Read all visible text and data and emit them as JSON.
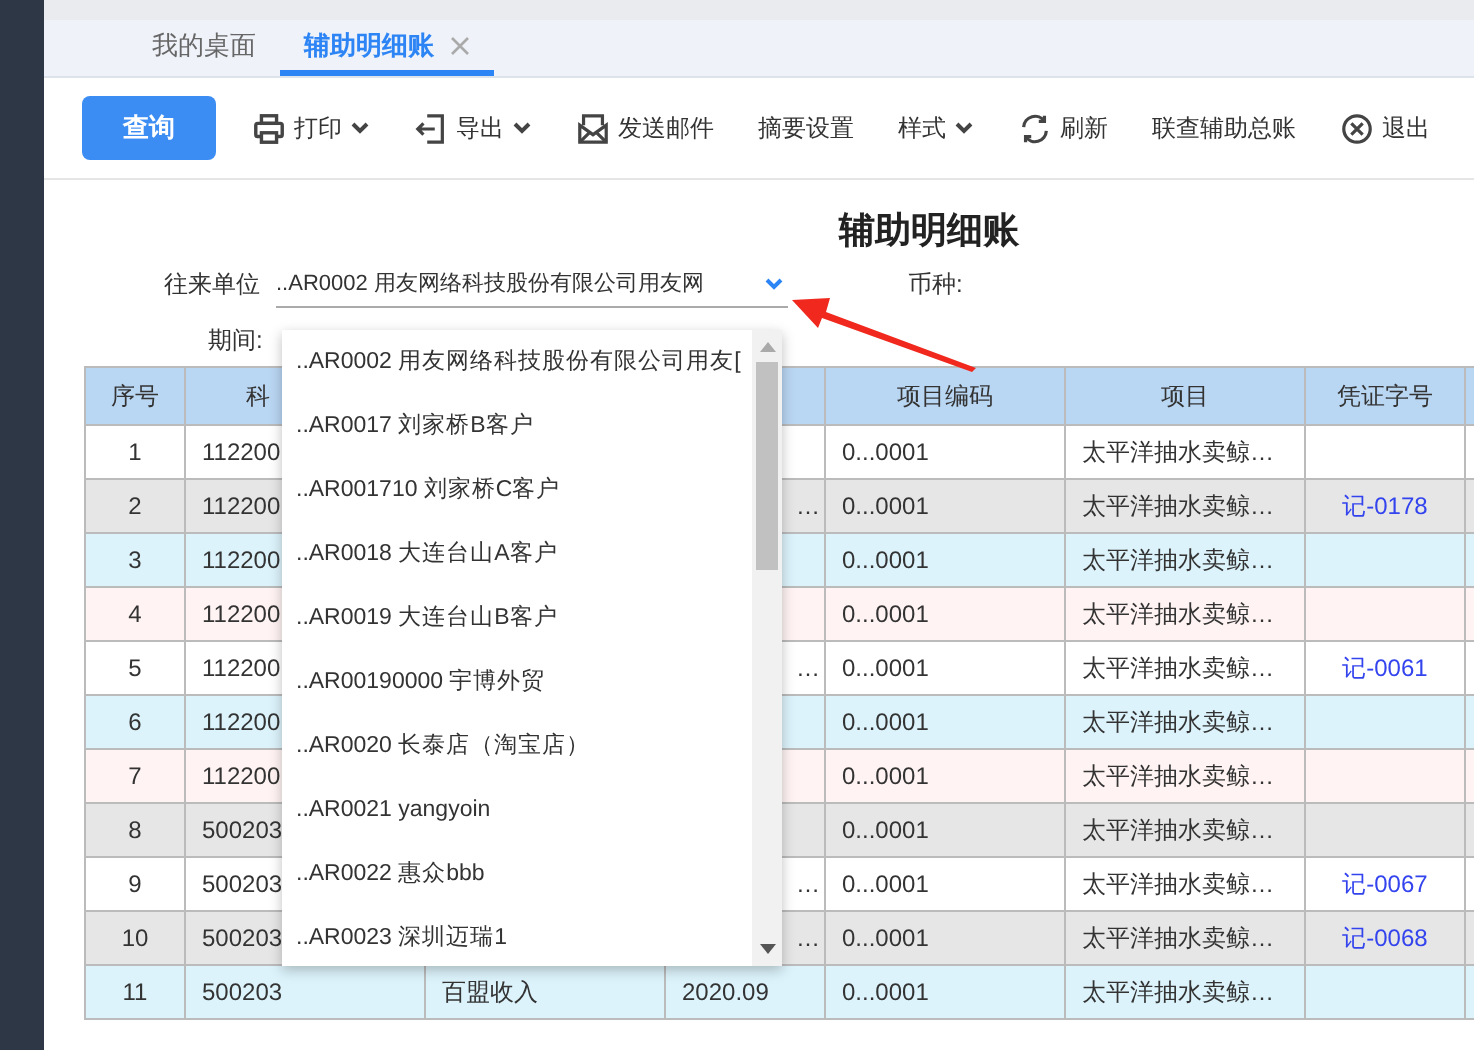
{
  "tabs": [
    {
      "label": "我的桌面",
      "selected": false,
      "closable": false
    },
    {
      "label": "辅助明细账",
      "selected": true,
      "closable": true
    }
  ],
  "toolbar": {
    "query_button": "查询",
    "items": [
      {
        "label": "打印",
        "kind": "print",
        "dropdown": true
      },
      {
        "label": "导出",
        "kind": "export",
        "dropdown": true
      },
      {
        "label": "发送邮件",
        "kind": "mail",
        "dropdown": false
      },
      {
        "label": "摘要设置",
        "kind": "text",
        "dropdown": false
      },
      {
        "label": "样式",
        "kind": "text",
        "dropdown": true
      },
      {
        "label": "刷新",
        "kind": "refresh",
        "dropdown": false
      },
      {
        "label": "联查辅助总账",
        "kind": "text",
        "dropdown": false
      },
      {
        "label": "退出",
        "kind": "exit",
        "dropdown": false
      }
    ]
  },
  "report": {
    "title": "辅助明细账",
    "unit_label": "往来单位",
    "unit_value": "..AR0002 用友网络科技股份有限公司用友网",
    "currency_label": "币种:",
    "period_label": "期间:"
  },
  "dropdown": {
    "options": [
      "..AR0002 用友网络科技股份有限公司用友[",
      "..AR0017 刘家桥B客户",
      "..AR001710 刘家桥C客户",
      "..AR0018 大连台山A客户",
      "..AR0019 大连台山B客户",
      "..AR00190000 宇博外贸",
      "..AR0020 长泰店（淘宝店）",
      "..AR0021 yangyoin",
      "..AR0022 惠众bbb",
      "..AR0023 深圳迈瑞1"
    ]
  },
  "table": {
    "columns": [
      "序号",
      "科",
      "",
      "",
      "项目编码",
      "项目",
      "凭证字号"
    ],
    "rows": [
      {
        "kind": "white",
        "cells": [
          "1",
          "112200",
          "",
          "",
          "0...0001",
          "太平洋抽水卖鲸…",
          ""
        ]
      },
      {
        "kind": "grey",
        "cells": [
          "2",
          "112200",
          "",
          "…",
          "0...0001",
          "太平洋抽水卖鲸…",
          "记-0178"
        ]
      },
      {
        "kind": "blue",
        "cells": [
          "3",
          "112200",
          "",
          "",
          "0...0001",
          "太平洋抽水卖鲸…",
          ""
        ]
      },
      {
        "kind": "pink",
        "cells": [
          "4",
          "112200",
          "",
          "",
          "0...0001",
          "太平洋抽水卖鲸…",
          ""
        ]
      },
      {
        "kind": "white",
        "cells": [
          "5",
          "112200",
          "",
          "…",
          "0...0001",
          "太平洋抽水卖鲸…",
          "记-0061"
        ]
      },
      {
        "kind": "blue",
        "cells": [
          "6",
          "112200",
          "",
          "",
          "0...0001",
          "太平洋抽水卖鲸…",
          ""
        ]
      },
      {
        "kind": "pink",
        "cells": [
          "7",
          "112200",
          "",
          "",
          "0...0001",
          "太平洋抽水卖鲸…",
          ""
        ]
      },
      {
        "kind": "grey",
        "cells": [
          "8",
          "500203",
          "",
          "",
          "0...0001",
          "太平洋抽水卖鲸…",
          ""
        ]
      },
      {
        "kind": "white",
        "cells": [
          "9",
          "500203",
          "",
          "…",
          "0...0001",
          "太平洋抽水卖鲸…",
          "记-0067"
        ]
      },
      {
        "kind": "grey",
        "cells": [
          "10",
          "500203",
          "",
          "…",
          "0...0001",
          "太平洋抽水卖鲸…",
          "记-0068"
        ]
      },
      {
        "kind": "blue",
        "cells": [
          "11",
          "500203",
          "百盟收入",
          "2020.09",
          "0...0001",
          "太平洋抽水卖鲸…",
          ""
        ]
      }
    ]
  }
}
